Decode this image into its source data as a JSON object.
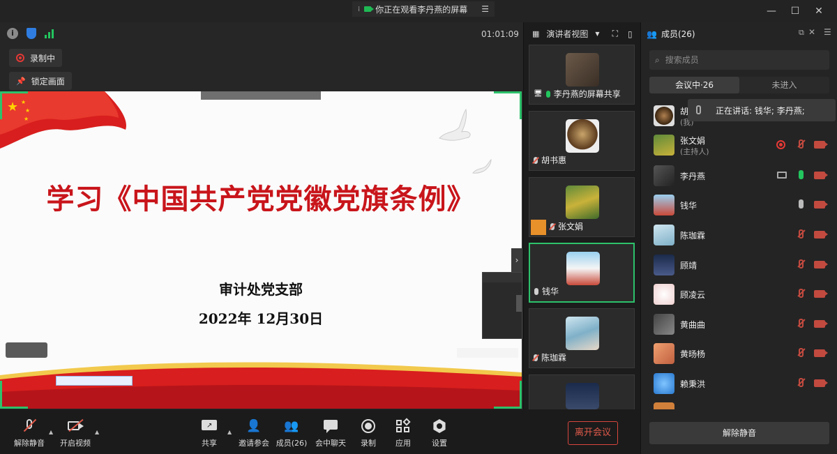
{
  "titlebar": {
    "watching": "你正在观看李丹燕的屏幕",
    "minimize": "—",
    "maximize": "☐",
    "close": "✕"
  },
  "main": {
    "timer": "01:01:09",
    "recording_label": "录制中",
    "lock_label": "锁定画面",
    "slide": {
      "title": "学习《中国共产党党徽党旗条例》",
      "department": "审计处党支部",
      "date": "2022年 12月30日"
    }
  },
  "thumbs": {
    "view_label": "演讲者视图",
    "tiles": [
      {
        "name": "李丹燕的屏幕共享"
      },
      {
        "name": "胡书惠"
      },
      {
        "name": "张文娟"
      },
      {
        "name": "钱华"
      },
      {
        "name": "陈珈霖"
      },
      {
        "name": ""
      }
    ]
  },
  "members": {
    "title": "成员(26)",
    "search_placeholder": "搜索成员",
    "tab_in": "会议中·26",
    "tab_out": "未进入",
    "speaking": "正在讲话: 钱华; 李丹燕;",
    "list": [
      {
        "name": "胡",
        "role": "(我)"
      },
      {
        "name": "张文娟",
        "role": "(主持人)"
      },
      {
        "name": "李丹燕",
        "role": ""
      },
      {
        "name": "钱华",
        "role": ""
      },
      {
        "name": "陈珈霖",
        "role": ""
      },
      {
        "name": "顾靖",
        "role": ""
      },
      {
        "name": "顾凌云",
        "role": ""
      },
      {
        "name": "黄曲曲",
        "role": ""
      },
      {
        "name": "黄旸杨",
        "role": ""
      },
      {
        "name": "赖秉洪",
        "role": ""
      }
    ],
    "unmute_all": "解除静音"
  },
  "toolbar": {
    "unmute": "解除静音",
    "start_video": "开启视频",
    "share": "共享",
    "invite": "邀请参会",
    "members": "成员(26)",
    "chat": "会中聊天",
    "record": "录制",
    "apps": "应用",
    "settings": "设置",
    "leave": "离开会议"
  },
  "colors": {
    "accent_green": "#2dc26b",
    "danger_red": "#e05a4a",
    "slide_title_red": "#c8151b"
  }
}
